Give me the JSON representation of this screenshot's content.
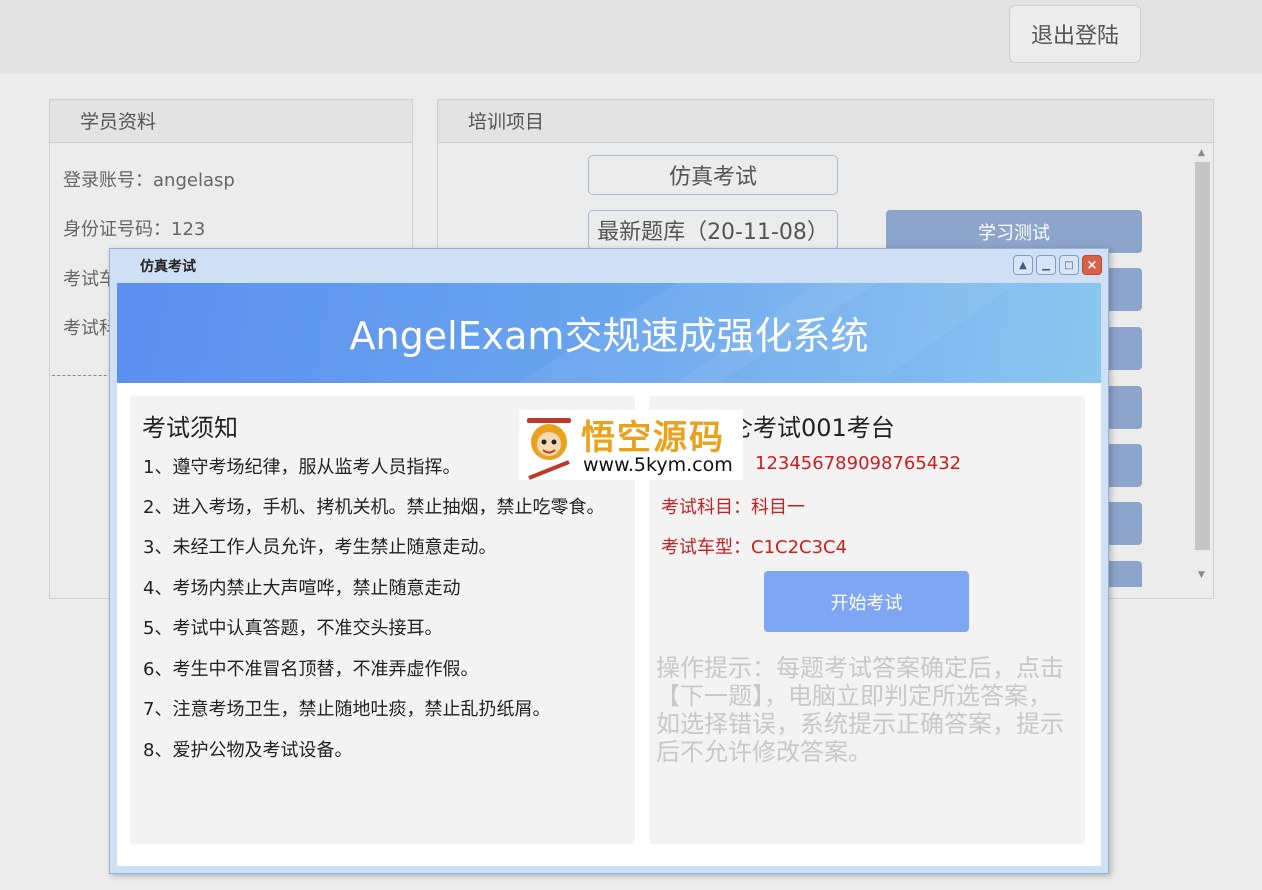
{
  "header": {
    "logout_label": "退出登陆"
  },
  "student": {
    "title": "学员资料",
    "account": "登录账号：angelasp",
    "id_number": "身份证号码：123",
    "car_type_partial": "考试车",
    "subject_partial": "考试科"
  },
  "training": {
    "title": "培训项目",
    "simulate_label": "仿真考试",
    "bank_label": "最新题库（20-11-08）",
    "study_test_label": "学习测试"
  },
  "dialog": {
    "title": "仿真考试",
    "banner": "AngelExam交规速成强化系统",
    "rules_heading": "考试须知",
    "rules": [
      "1、遵守考场纪律，服从监考人员指挥。",
      "2、进入考场，手机、拷机关机。禁止抽烟，禁止吃零食。",
      "3、未经工作人员允许，考生禁止随意走动。",
      "4、考场内禁止大声喧哗，禁止随意走动",
      "5、考试中认真答题，不准交头接耳。",
      "6、考生中不准冒名顶替，不准弄虚作假。",
      "7、注意考场卫生，禁止随地吐痰，禁止乱扔纸屑。",
      "8、爱护公物及考试设备。"
    ],
    "exam_name": "仑考试001考台",
    "id_value": "12345678909876543​2",
    "subject": "考试科目：科目一",
    "car_type": "考试车型：C1C2C3C4",
    "start_label": "开始考试",
    "hint": "操作提示：每题考试答案确定后，点击【下一题】，电脑立即判定所选答案，如选择错误，系统提示正确答案，提示后不允许修改答案。"
  },
  "watermark": {
    "text": "悟空源码",
    "url": "www.5kym.com"
  },
  "icons": [
    "minimize-icon",
    "restore-icon",
    "maximize-icon",
    "close-icon"
  ]
}
